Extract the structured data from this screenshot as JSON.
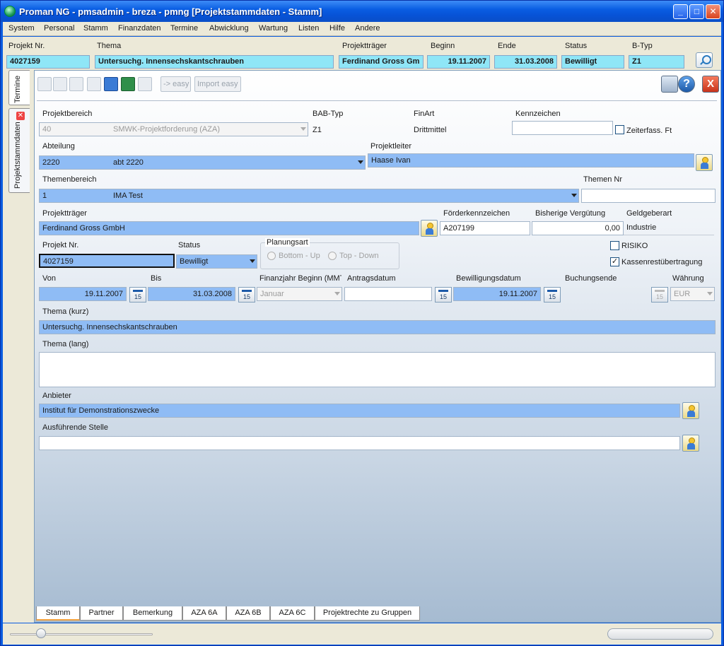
{
  "window": {
    "title": "Proman NG - pmsadmin - breza - pmng [Projektstammdaten - Stamm]"
  },
  "menu": [
    "System",
    "Personal",
    "Stamm",
    "Finanzdaten",
    "Termine",
    "Abwicklung",
    "Wartung",
    "Listen",
    "Hilfe",
    "Andere"
  ],
  "header": {
    "projekt_nr_label": "Projekt Nr.",
    "projekt_nr": "4027159",
    "thema_label": "Thema",
    "thema": "Untersuchg. Innensechskantschrauben",
    "projekttraeger_label": "Projektträger",
    "projekttraeger": "Ferdinand Gross Gm",
    "beginn_label": "Beginn",
    "beginn": "19.11.2007",
    "ende_label": "Ende",
    "ende": "31.03.2008",
    "status_label": "Status",
    "status": "Bewilligt",
    "btyp_label": "B-Typ",
    "btyp": "Z1"
  },
  "sidetabs": {
    "termine": "Termine",
    "projektstammdaten": "Projektstammdaten"
  },
  "toolbar": {
    "easy": "-> easy",
    "import_easy": "Import easy",
    "help": "?",
    "close": "X"
  },
  "form": {
    "projektbereich_label": "Projektbereich",
    "projektbereich_code": "40",
    "projektbereich_text": "SMWK-Projektforderung (AZA)",
    "babtyp_label": "BAB-Typ",
    "babtyp": "Z1",
    "finart_label": "FinArt",
    "finart": "Drittmittel",
    "kennzeichen_label": "Kennzeichen",
    "kennzeichen": "",
    "zeiterfass_label": "Zeiterfass. Ft",
    "abteilung_label": "Abteilung",
    "abteilung_code": "2220",
    "abteilung_text": "abt 2220",
    "projektleiter_label": "Projektleiter",
    "projektleiter": "Haase Ivan",
    "themenbereich_label": "Themenbereich",
    "themenbereich_code": "1",
    "themenbereich_text": "IMA Test",
    "themen_nr_label": "Themen Nr",
    "themen_nr": "",
    "projekttraeger_label": "Projektträger",
    "projekttraeger": "Ferdinand Gross GmbH",
    "foerderkennzeichen_label": "Förderkennzeichen",
    "foerderkennzeichen": "A207199",
    "verguetung_label": "Bisherige Vergütung",
    "verguetung": "0,00",
    "geldgeberart_label": "Geldgeberart",
    "geldgeberart": "Industrie",
    "projekt_nr_label": "Projekt Nr.",
    "projekt_nr": "4027159",
    "status_label": "Status",
    "status": "Bewilligt",
    "planungsart_label": "Planungsart",
    "bottom_up": "Bottom - Up",
    "top_down": "Top - Down",
    "risiko_label": "RISIKO",
    "kassen_label": "Kassenrestübertragung",
    "kassen_check": "✓",
    "von_label": "Von",
    "von": "19.11.2007",
    "bis_label": "Bis",
    "bis": "31.03.2008",
    "finanzjahr_label": "Finanzjahr Beginn (MMT",
    "finanzjahr": "Januar",
    "antragsdatum_label": "Antragsdatum",
    "antragsdatum": "",
    "bewilligungsdatum_label": "Bewilligungsdatum",
    "bewilligungsdatum": "19.11.2007",
    "buchungsende_label": "Buchungsende",
    "buchungsende": "",
    "waehrung_label": "Währung",
    "waehrung": "EUR",
    "cal_label": "15",
    "thema_kurz_label": "Thema (kurz)",
    "thema_kurz": "Untersuchg. Innensechskantschrauben",
    "thema_lang_label": "Thema (lang)",
    "thema_lang": "",
    "anbieter_label": "Anbieter",
    "anbieter": "Institut für Demonstrationszwecke",
    "ausfuehrende_label": "Ausführende Stelle",
    "ausfuehrende": ""
  },
  "tabs": [
    "Stamm",
    "Partner",
    "Bemerkung",
    "AZA 6A",
    "AZA 6B",
    "AZA 6C",
    "Projektrechte zu Gruppen"
  ]
}
